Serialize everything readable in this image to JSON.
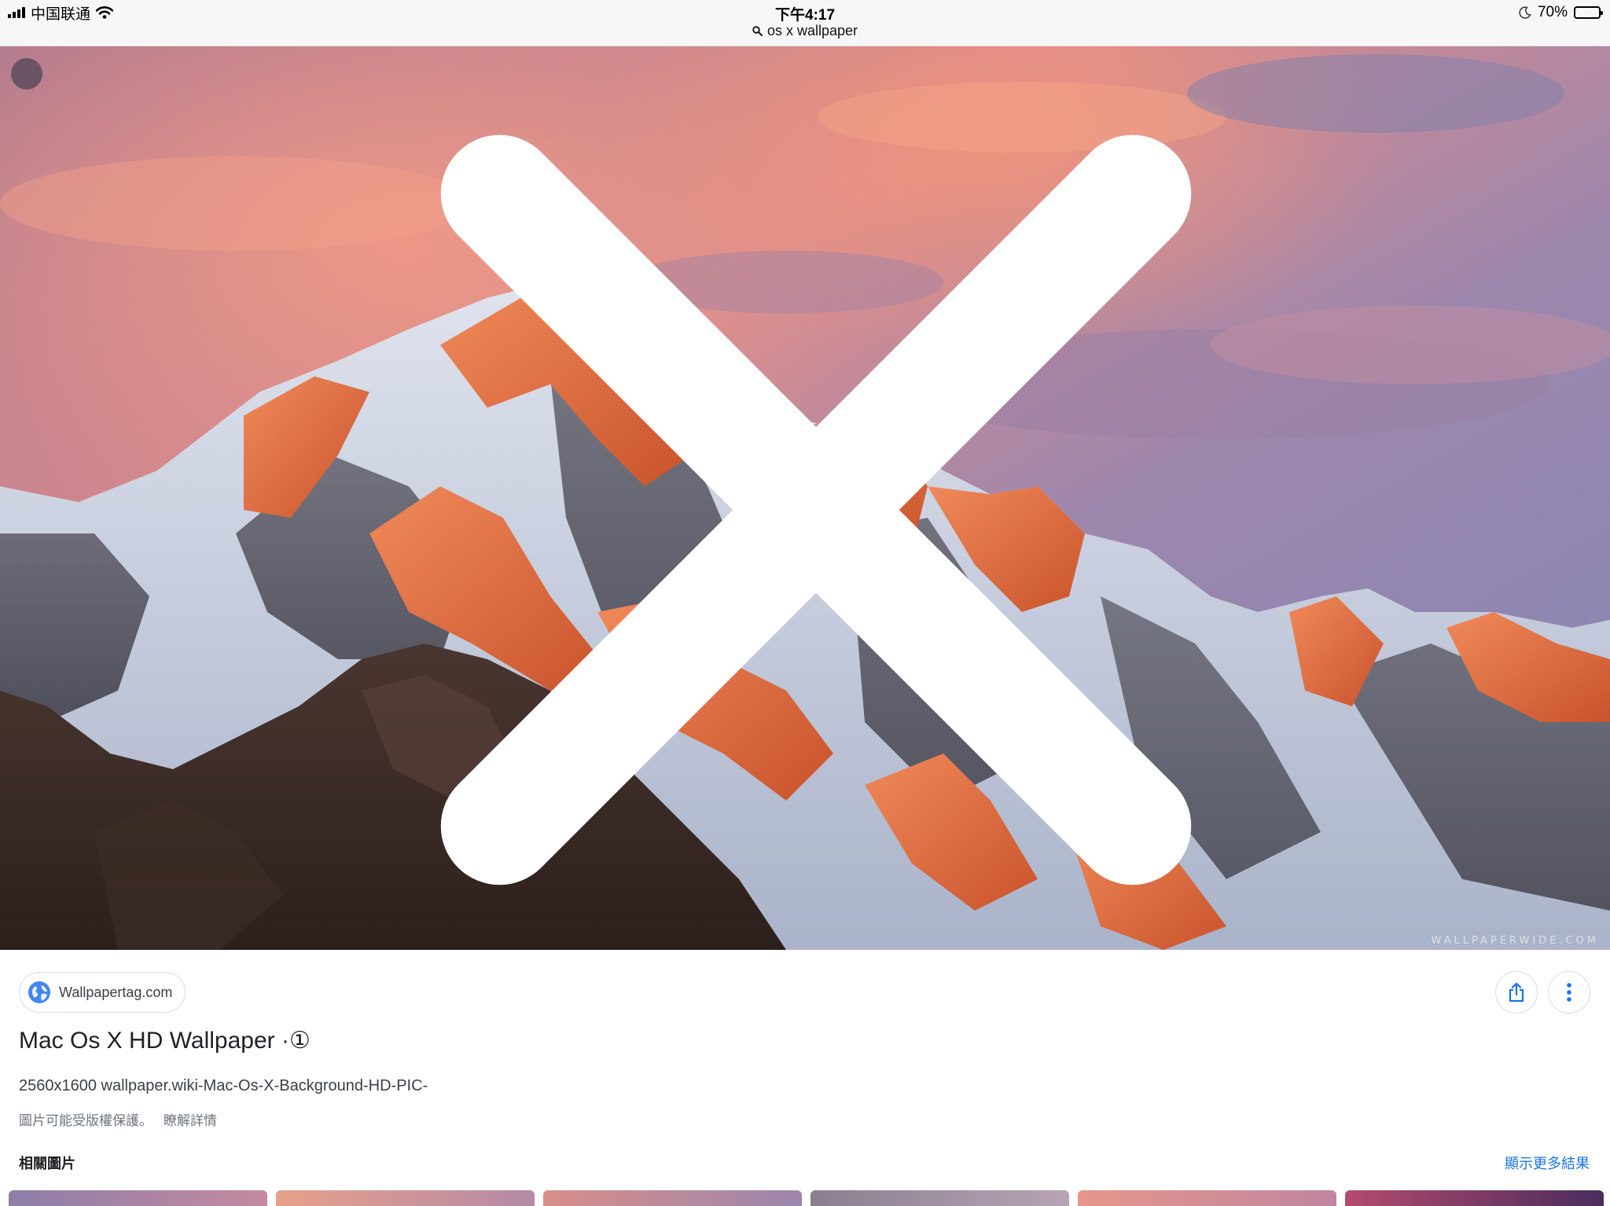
{
  "status_bar": {
    "carrier": "中国联通",
    "time": "下午4:17",
    "search_query": "os x wallpaper",
    "battery_percent": "70%",
    "battery_level": 0.7
  },
  "image_viewer": {
    "watermark": "WALLPAPERWIDE.COM",
    "source_name": "Wallpapertag.com",
    "title": "Mac Os X HD Wallpaper ·①",
    "description": "2560x1600 wallpaper.wiki-Mac-Os-X-Background-HD-PIC-",
    "copyright_notice": "圖片可能受版權保護。",
    "learn_more": "瞭解詳情"
  },
  "related": {
    "heading": "相關圖片",
    "show_more": "顯示更多結果",
    "thumbnails": [
      {
        "colors": [
          "#8d7ea8",
          "#c48aa0"
        ]
      },
      {
        "colors": [
          "#e7a18a",
          "#b48aa6"
        ]
      },
      {
        "colors": [
          "#d98e88",
          "#9b86ae"
        ]
      },
      {
        "colors": [
          "#8a7f90",
          "#b7a4b4"
        ]
      },
      {
        "colors": [
          "#e6968a",
          "#c086a0"
        ]
      },
      {
        "colors": [
          "#b34b6e",
          "#4a2c5c"
        ]
      }
    ]
  },
  "colors": {
    "accent_link": "#1a73e8",
    "text_primary": "#202124",
    "text_secondary": "#70757a"
  },
  "icons": {
    "close": "close-icon",
    "globe": "globe-icon",
    "share": "share-icon",
    "more": "more-vert-icon",
    "search": "search-icon",
    "wifi": "wifi-icon",
    "moon": "moon-icon",
    "battery": "battery-icon"
  }
}
